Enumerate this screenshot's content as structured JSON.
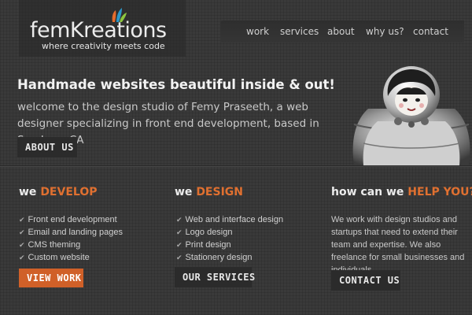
{
  "header": {
    "logo_text": "femKreations",
    "tagline": "where creativity meets code",
    "nav": [
      "work",
      "services",
      "about",
      "why us?",
      "contact"
    ]
  },
  "hero": {
    "title": "Handmade websites beautiful inside & out!",
    "text": "welcome to the design studio of Femy Praseeth, a web designer specializing in front end development, based in San Jose, CA",
    "button": "ABOUT US"
  },
  "columns": {
    "develop": {
      "head_prefix": "we ",
      "head_accent": "DEVELOP",
      "items": [
        "Front end development",
        "Email and landing pages",
        "CMS theming",
        "Custom website"
      ],
      "button": "VIEW WORK"
    },
    "design": {
      "head_prefix": "we ",
      "head_accent": "DESIGN",
      "items": [
        "Web and interface design",
        "Logo design",
        "Print design",
        "Stationery design"
      ],
      "button": "OUR SERVICES"
    },
    "help": {
      "head_prefix": "how can we ",
      "head_accent": "HELP YOU?",
      "text": "We work with design studios and startups that need to extend their team and expertise. We also freelance for small businesses and individuals.",
      "button": "CONTACT US"
    }
  },
  "icons": {
    "check": "checkmark-icon",
    "logo_mark": "paint-splash-icon",
    "hero_image": "nesting-doll-image"
  },
  "colors": {
    "accent": "#e07030",
    "button_orange": "#d06028",
    "background": "#3a3a3a"
  }
}
